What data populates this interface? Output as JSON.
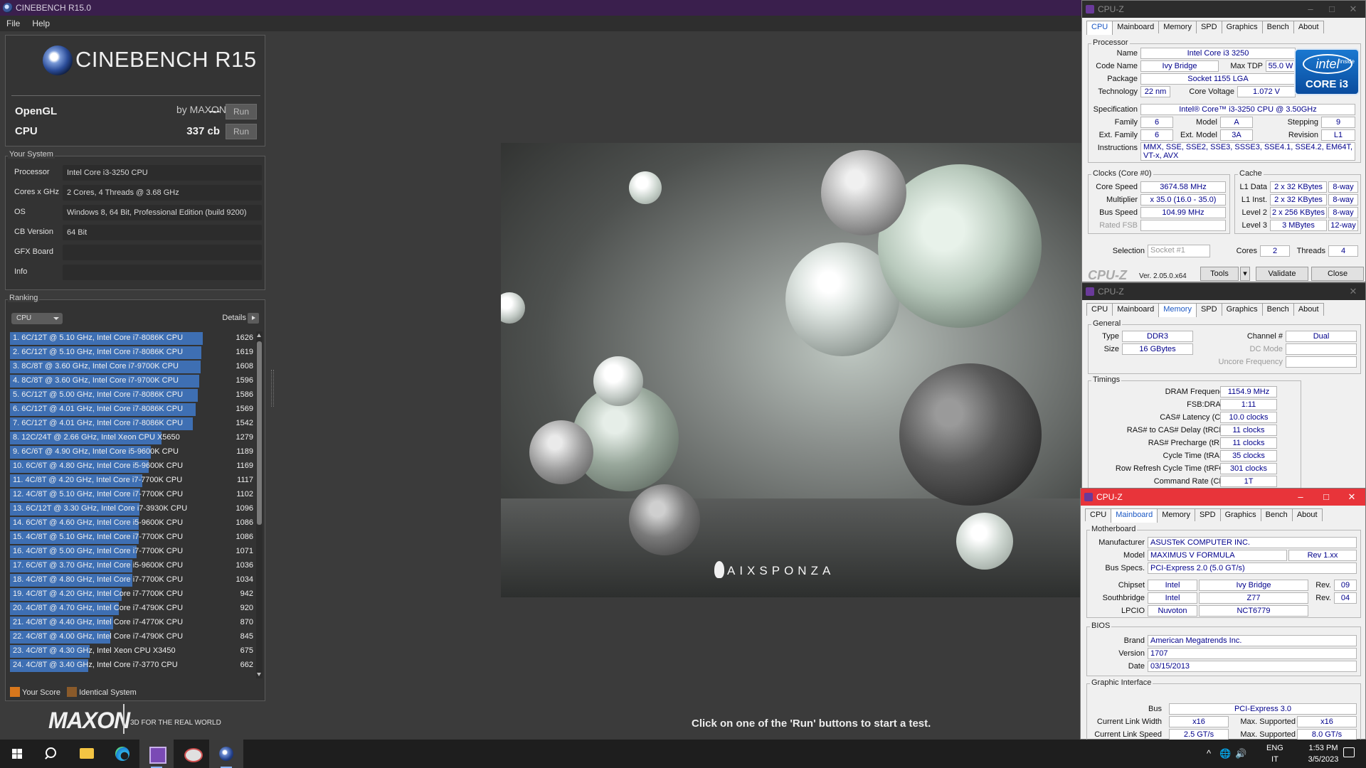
{
  "cinebench": {
    "title": "CINEBENCH R15.0",
    "menu": [
      "File",
      "Help"
    ],
    "logo": {
      "name": "CINEBENCH R15",
      "by": "by MAXON"
    },
    "opengl": {
      "label": "OpenGL",
      "value": "---",
      "button": "Run"
    },
    "cpu": {
      "label": "CPU",
      "value": "337 cb",
      "button": "Run"
    },
    "system": {
      "caption": "Your System",
      "rows": [
        {
          "label": "Processor",
          "value": "Intel Core i3-3250 CPU"
        },
        {
          "label": "Cores x GHz",
          "value": "2 Cores, 4 Threads @ 3.68 GHz"
        },
        {
          "label": "OS",
          "value": "Windows 8, 64 Bit, Professional Edition (build 9200)"
        },
        {
          "label": "CB Version",
          "value": "64 Bit"
        },
        {
          "label": "GFX Board",
          "value": ""
        },
        {
          "label": "Info",
          "value": ""
        }
      ]
    },
    "ranking": {
      "caption": "Ranking",
      "select": "CPU",
      "details": "Details",
      "max_score": 1626,
      "items": [
        {
          "label": "1. 6C/12T @ 5.10 GHz, Intel Core i7-8086K CPU",
          "score": 1626
        },
        {
          "label": "2. 6C/12T @ 5.10 GHz, Intel Core i7-8086K CPU",
          "score": 1619
        },
        {
          "label": "3. 8C/8T @ 3.60 GHz, Intel Core i7-9700K CPU",
          "score": 1608
        },
        {
          "label": "4. 8C/8T @ 3.60 GHz, Intel Core i7-9700K CPU",
          "score": 1596
        },
        {
          "label": "5. 6C/12T @ 5.00 GHz, Intel Core i7-8086K CPU",
          "score": 1586
        },
        {
          "label": "6. 6C/12T @ 4.01 GHz, Intel Core i7-8086K CPU",
          "score": 1569
        },
        {
          "label": "7. 6C/12T @ 4.01 GHz, Intel Core i7-8086K CPU",
          "score": 1542
        },
        {
          "label": "8. 12C/24T @ 2.66 GHz, Intel Xeon CPU X5650",
          "score": 1279
        },
        {
          "label": "9. 6C/6T @ 4.90 GHz, Intel Core i5-9600K CPU",
          "score": 1189
        },
        {
          "label": "10. 6C/6T @ 4.80 GHz, Intel Core i5-9600K CPU",
          "score": 1169
        },
        {
          "label": "11. 4C/8T @ 4.20 GHz, Intel Core i7-7700K CPU",
          "score": 1117
        },
        {
          "label": "12. 4C/8T @ 5.10 GHz, Intel Core i7-7700K CPU",
          "score": 1102
        },
        {
          "label": "13. 6C/12T @ 3.30 GHz,  Intel Core i7-3930K CPU",
          "score": 1096
        },
        {
          "label": "14. 6C/6T @ 4.60 GHz, Intel Core i5-9600K CPU",
          "score": 1086
        },
        {
          "label": "15. 4C/8T @ 5.10 GHz, Intel Core i7-7700K CPU",
          "score": 1086
        },
        {
          "label": "16. 4C/8T @ 5.00 GHz, Intel Core i7-7700K CPU",
          "score": 1071
        },
        {
          "label": "17. 6C/6T @ 3.70 GHz, Intel Core i5-9600K CPU",
          "score": 1036
        },
        {
          "label": "18. 4C/8T @ 4.80 GHz, Intel Core i7-7700K CPU",
          "score": 1034
        },
        {
          "label": "19. 4C/8T @ 4.20 GHz, Intel Core i7-7700K CPU",
          "score": 942
        },
        {
          "label": "20. 4C/8T @ 4.70 GHz, Intel Core i7-4790K CPU",
          "score": 920
        },
        {
          "label": "21. 4C/8T @ 4.40 GHz, Intel Core i7-4770K CPU",
          "score": 870
        },
        {
          "label": "22. 4C/8T @ 4.00 GHz, Intel Core i7-4790K CPU",
          "score": 845
        },
        {
          "label": "23. 4C/8T @ 4.30 GHz, Intel Xeon CPU X3450",
          "score": 675
        },
        {
          "label": "24. 4C/8T @ 3.40 GHz,  Intel Core i7-3770 CPU",
          "score": 662
        }
      ],
      "legend": {
        "your_score": "Your Score",
        "identical": "Identical System"
      },
      "colors": {
        "bar": "#3e6fb3",
        "your_score": "#d8771c",
        "identical": "#8a5a2a"
      }
    },
    "maxon": {
      "logo": "MAXON",
      "tagline": "3D FOR THE REAL WORLD"
    },
    "render_brand": "AIXSPONZA",
    "status": "Click on one of the 'Run' buttons to start a test."
  },
  "cpuz_cpu": {
    "title": "CPU-Z",
    "tabs": [
      "CPU",
      "Mainboard",
      "Memory",
      "SPD",
      "Graphics",
      "Bench",
      "About"
    ],
    "processor_caption": "Processor",
    "name_label": "Name",
    "name": "Intel Core i3 3250",
    "codename_label": "Code Name",
    "codename": "Ivy Bridge",
    "maxtdp_label": "Max TDP",
    "maxtdp": "55.0 W",
    "package_label": "Package",
    "package": "Socket 1155 LGA",
    "technology_label": "Technology",
    "technology": "22 nm",
    "voltage_label": "Core Voltage",
    "voltage": "1.072 V",
    "spec_label": "Specification",
    "spec": "Intel® Core™ i3-3250 CPU @ 3.50GHz",
    "family_label": "Family",
    "family": "6",
    "model_label": "Model",
    "model": "A",
    "stepping_label": "Stepping",
    "stepping": "9",
    "extfamily_label": "Ext. Family",
    "extfamily": "6",
    "extmodel_label": "Ext. Model",
    "extmodel": "3A",
    "revision_label": "Revision",
    "revision": "L1",
    "instr_label": "Instructions",
    "instr": "MMX, SSE, SSE2, SSE3, SSSE3, SSE4.1, SSE4.2, EM64T, VT-x, AVX",
    "clocks_caption": "Clocks (Core #0)",
    "corespeed_label": "Core Speed",
    "corespeed": "3674.58 MHz",
    "multiplier_label": "Multiplier",
    "multiplier": "x 35.0 (16.0 - 35.0)",
    "busspeed_label": "Bus Speed",
    "busspeed": "104.99 MHz",
    "ratedfsb_label": "Rated FSB",
    "cache_caption": "Cache",
    "l1d_label": "L1 Data",
    "l1d": "2 x 32 KBytes",
    "l1d_way": "8-way",
    "l1i_label": "L1 Inst.",
    "l1i": "2 x 32 KBytes",
    "l1i_way": "8-way",
    "l2_label": "Level 2",
    "l2": "2 x 256 KBytes",
    "l2_way": "8-way",
    "l3_label": "Level 3",
    "l3": "3 MBytes",
    "l3_way": "12-way",
    "selection_label": "Selection",
    "selection": "Socket #1",
    "cores_label": "Cores",
    "cores": "2",
    "threads_label": "Threads",
    "threads": "4",
    "brand": "CPU-Z",
    "version": "Ver. 2.05.0.x64",
    "tools": "Tools",
    "validate": "Validate",
    "close": "Close",
    "badge_brand": "intel",
    "badge_inside": "inside",
    "badge_model": "CORE i3"
  },
  "cpuz_mem": {
    "title": "CPU-Z",
    "tabs": [
      "CPU",
      "Mainboard",
      "Memory",
      "SPD",
      "Graphics",
      "Bench",
      "About"
    ],
    "general_caption": "General",
    "type_label": "Type",
    "type": "DDR3",
    "channel_label": "Channel #",
    "channel": "Dual",
    "size_label": "Size",
    "size": "16 GBytes",
    "dcmode_label": "DC Mode",
    "uncore_label": "Uncore Frequency",
    "timings_caption": "Timings",
    "timings": [
      {
        "label": "DRAM Frequency",
        "value": "1154.9 MHz"
      },
      {
        "label": "FSB:DRAM",
        "value": "1:11"
      },
      {
        "label": "CAS# Latency (CL)",
        "value": "10.0 clocks"
      },
      {
        "label": "RAS# to CAS# Delay (tRCD)",
        "value": "11 clocks"
      },
      {
        "label": "RAS# Precharge (tRP)",
        "value": "11 clocks"
      },
      {
        "label": "Cycle Time (tRAS)",
        "value": "35 clocks"
      },
      {
        "label": "Row Refresh Cycle Time (tRFC)",
        "value": "301 clocks"
      },
      {
        "label": "Command Rate (CR)",
        "value": "1T"
      }
    ]
  },
  "cpuz_mb": {
    "title": "CPU-Z",
    "tabs": [
      "CPU",
      "Mainboard",
      "Memory",
      "SPD",
      "Graphics",
      "Bench",
      "About"
    ],
    "mb_caption": "Motherboard",
    "manufacturer_label": "Manufacturer",
    "manufacturer": "ASUSTeK COMPUTER INC.",
    "model_label": "Model",
    "model": "MAXIMUS V FORMULA",
    "model_rev": "Rev 1.xx",
    "busspecs_label": "Bus Specs.",
    "busspecs": "PCI-Express 2.0 (5.0 GT/s)",
    "chipset_label": "Chipset",
    "chipset_vendor": "Intel",
    "chipset": "Ivy Bridge",
    "chipset_rev_label": "Rev.",
    "chipset_rev": "09",
    "south_label": "Southbridge",
    "south_vendor": "Intel",
    "south": "Z77",
    "south_rev_label": "Rev.",
    "south_rev": "04",
    "lpcio_label": "LPCIO",
    "lpcio_vendor": "Nuvoton",
    "lpcio": "NCT6779",
    "bios_caption": "BIOS",
    "brand_label": "Brand",
    "brand": "American Megatrends Inc.",
    "version_label": "Version",
    "version": "1707",
    "date_label": "Date",
    "date": "03/15/2013",
    "gi_caption": "Graphic Interface",
    "bus_label": "Bus",
    "bus": "PCI-Express 3.0",
    "clw_label": "Current Link Width",
    "clw": "x16",
    "ms1_label": "Max. Supported",
    "ms1": "x16",
    "cls_label": "Current Link Speed",
    "cls": "2.5 GT/s",
    "ms2_label": "Max. Supported",
    "ms2": "8.0 GT/s"
  },
  "taskbar": {
    "lang": "ENG",
    "region": "IT",
    "time": "1:53 PM",
    "date": "3/5/2023"
  }
}
